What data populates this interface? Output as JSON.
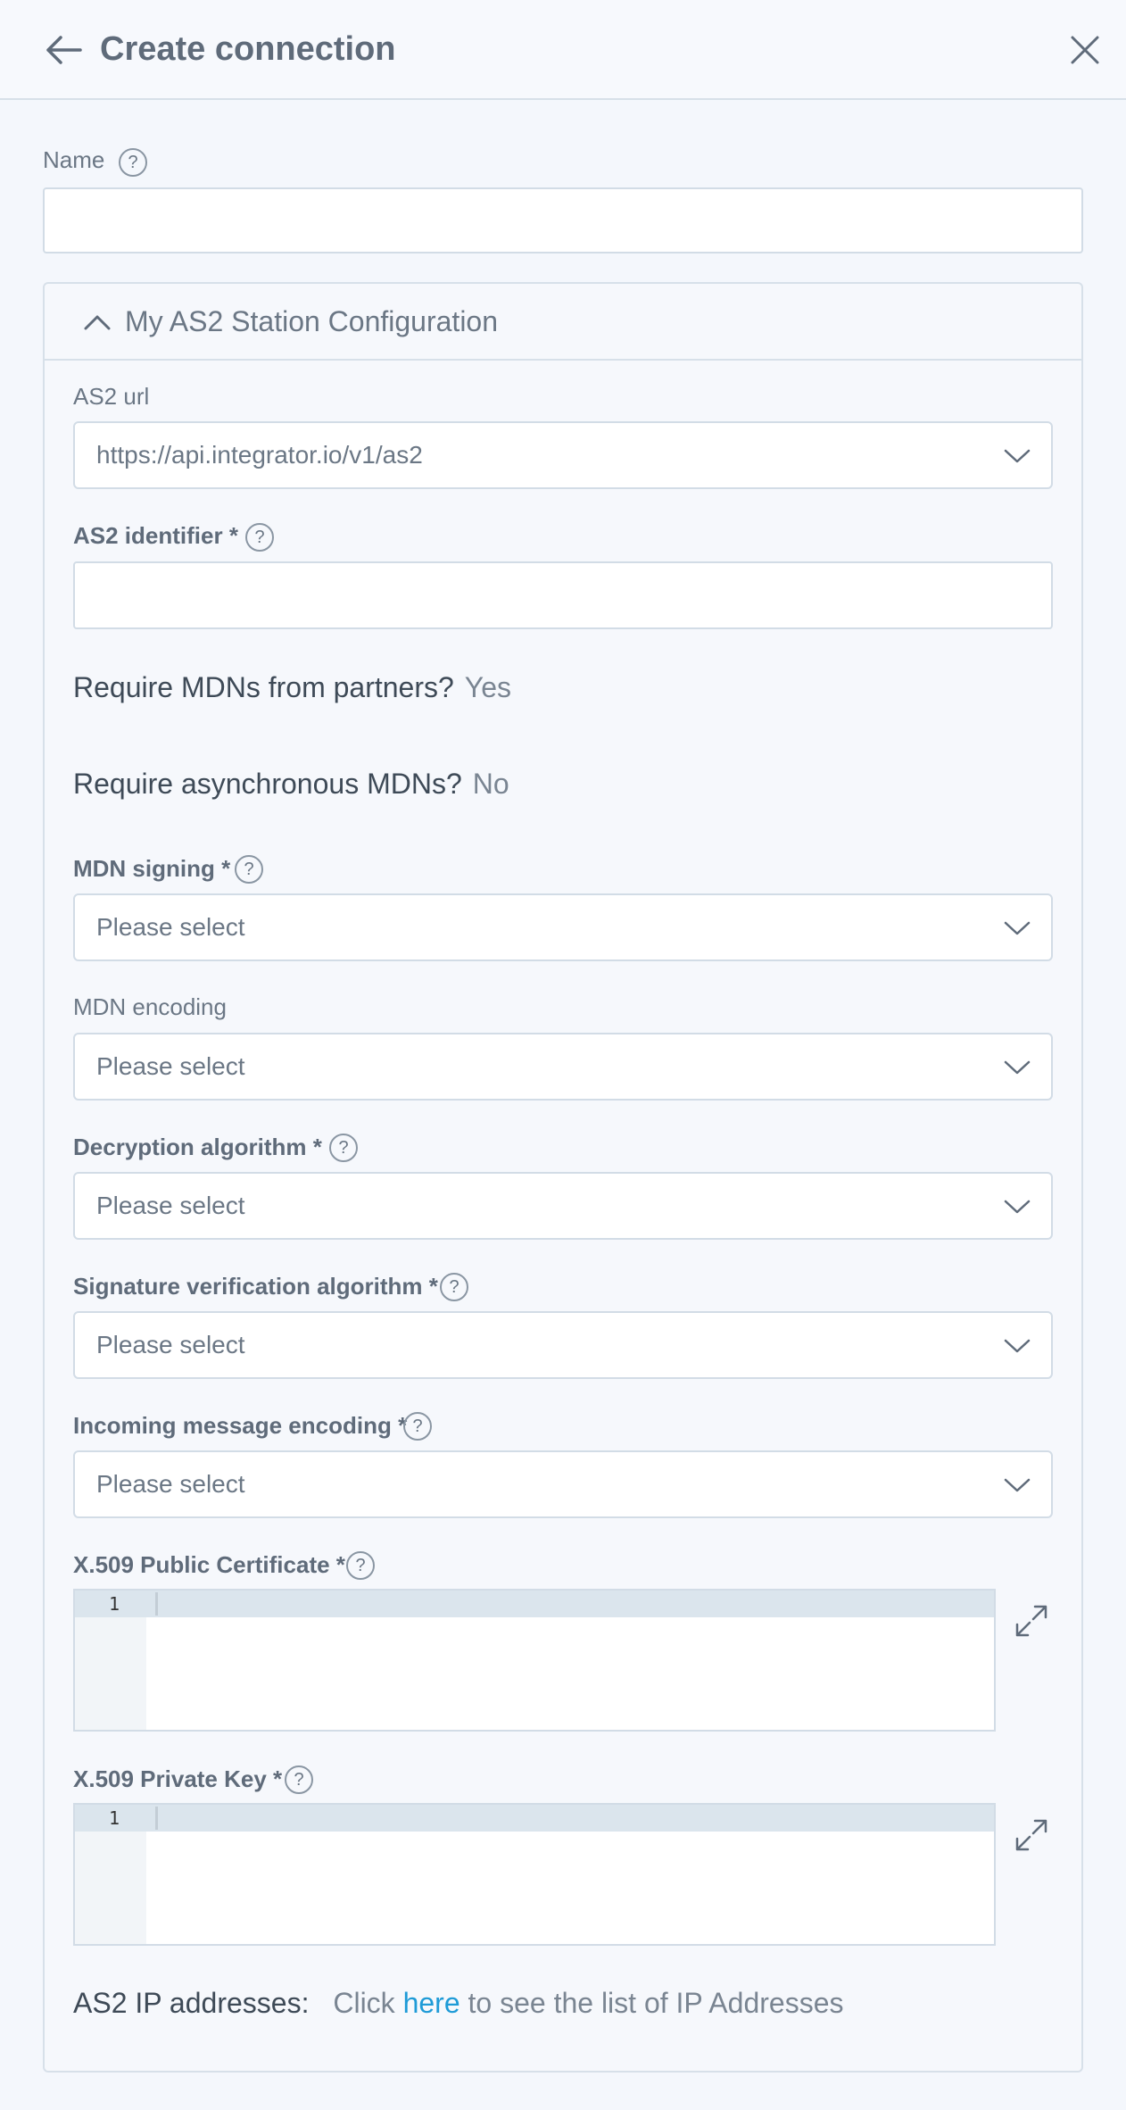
{
  "header": {
    "title": "Create connection"
  },
  "name_field": {
    "label": "Name",
    "value": "",
    "help": "?"
  },
  "section": {
    "title": "My AS2 Station Configuration",
    "as2_url": {
      "label": "AS2 url",
      "value": "https://api.integrator.io/v1/as2"
    },
    "as2_identifier": {
      "label": "AS2 identifier *",
      "value": "",
      "help": "?"
    },
    "require_mdns": {
      "label": "Require MDNs from partners?",
      "value": "Yes"
    },
    "require_async": {
      "label": "Require asynchronous MDNs?",
      "value": "No"
    },
    "mdn_signing": {
      "label": "MDN signing *",
      "value": "Please select",
      "help": "?"
    },
    "mdn_encoding": {
      "label": "MDN encoding",
      "value": "Please select"
    },
    "decryption_algorithm": {
      "label": "Decryption algorithm *",
      "value": "Please select",
      "help": "?"
    },
    "signature_verification": {
      "label": "Signature verification algorithm *",
      "value": "Please select",
      "help": "?"
    },
    "incoming_encoding": {
      "label": "Incoming message encoding *",
      "value": "Please select",
      "help": "?"
    },
    "public_cert": {
      "label": "X.509 Public Certificate *",
      "line_number": "1",
      "help": "?"
    },
    "private_key": {
      "label": "X.509 Private Key *",
      "line_number": "1",
      "help": "?"
    },
    "ip_addresses": {
      "label": "AS2 IP addresses:",
      "prefix": "Click",
      "link": "here",
      "suffix": "to see the list of IP Addresses"
    }
  },
  "colors": {
    "link": "#1f9bd7",
    "border": "#d2dce6",
    "background": "#f4f7fc"
  }
}
